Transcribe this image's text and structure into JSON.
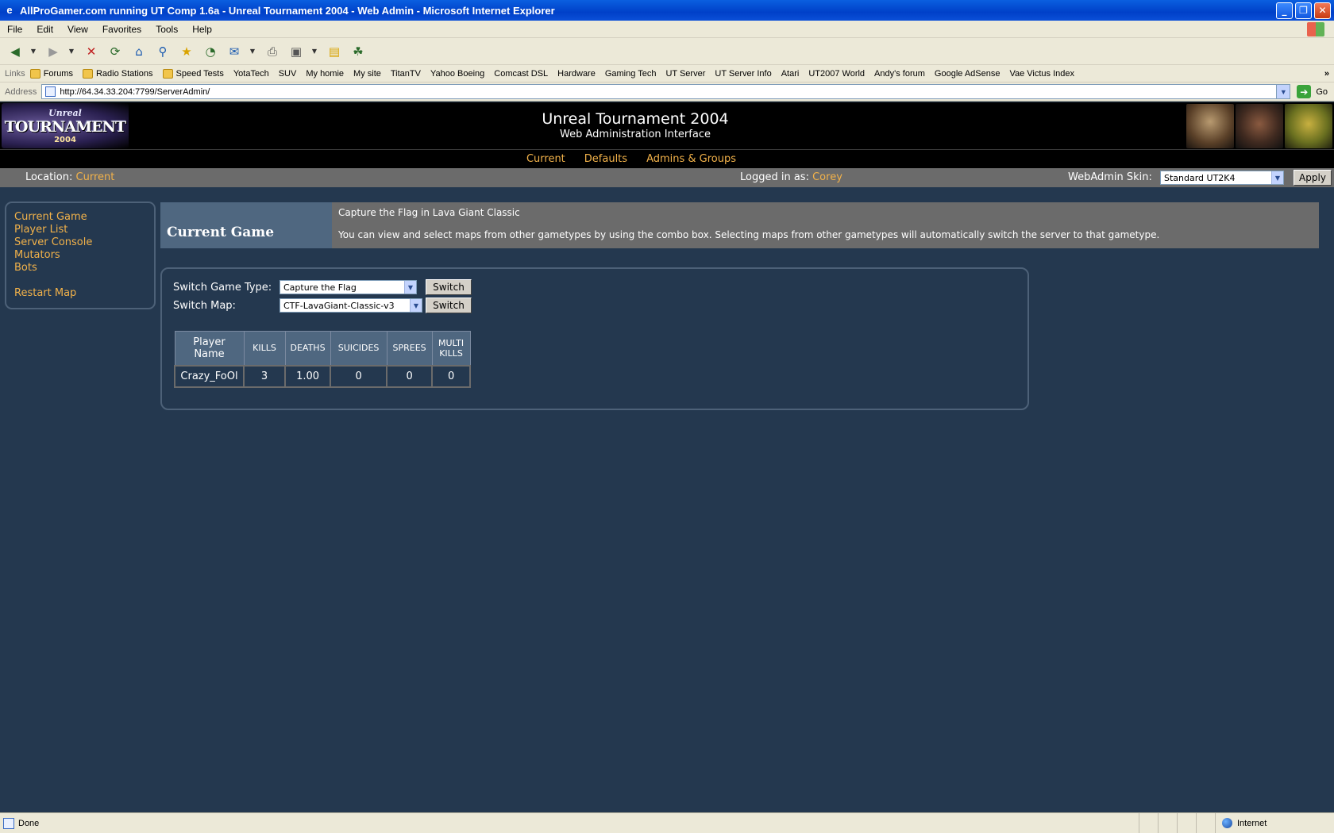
{
  "browser": {
    "title": "AllProGamer.com  running UT Comp 1.6a - Unreal Tournament 2004 - Web Admin - Microsoft Internet Explorer",
    "menu": [
      "File",
      "Edit",
      "View",
      "Favorites",
      "Tools",
      "Help"
    ],
    "links_label": "Links",
    "links": [
      {
        "label": "Forums",
        "icon": "folder-icon"
      },
      {
        "label": "Radio Stations",
        "icon": "folder-icon"
      },
      {
        "label": "Speed Tests",
        "icon": "folder-icon"
      },
      {
        "label": "YotaTech",
        "icon": "page-icon"
      },
      {
        "label": "SUV",
        "icon": "page-icon"
      },
      {
        "label": "My homie",
        "icon": "page-icon"
      },
      {
        "label": "My site",
        "icon": "page-icon"
      },
      {
        "label": "TitanTV",
        "icon": "page-icon"
      },
      {
        "label": "Yahoo Boeing",
        "icon": "page-icon"
      },
      {
        "label": "Comcast DSL",
        "icon": "page-icon"
      },
      {
        "label": "Hardware",
        "icon": "page-icon"
      },
      {
        "label": "Gaming Tech",
        "icon": "page-icon"
      },
      {
        "label": "UT Server",
        "icon": "page-icon"
      },
      {
        "label": "UT Server Info",
        "icon": "page-icon"
      },
      {
        "label": "Atari",
        "icon": "page-icon"
      },
      {
        "label": "UT2007 World",
        "icon": "page-icon"
      },
      {
        "label": "Andy's forum",
        "icon": "page-icon"
      },
      {
        "label": "Google AdSense",
        "icon": "page-icon"
      },
      {
        "label": "Vae Victus  Index",
        "icon": "page-icon"
      }
    ],
    "more_links": "»",
    "address_label": "Address",
    "address_url": "http://64.34.33.204:7799/ServerAdmin/",
    "go_label": "Go",
    "status_text": "Done",
    "zone_text": "Internet"
  },
  "header": {
    "logo": {
      "line1": "Unreal",
      "line2": "TOURNAMENT",
      "line3": "2004"
    },
    "title": "Unreal Tournament 2004",
    "subtitle": "Web Administration Interface"
  },
  "nav": [
    "Current",
    "Defaults",
    "Admins & Groups"
  ],
  "locbar": {
    "location_label": "Location:",
    "location_value": "Current",
    "logged_label": "Logged in as:",
    "logged_value": "Corey",
    "skin_label": "WebAdmin Skin:",
    "skin_value": "Standard UT2K4",
    "apply_label": "Apply"
  },
  "sidebar": {
    "items": [
      "Current Game",
      "Player List",
      "Server Console",
      "Mutators",
      "Bots"
    ],
    "extra": "Restart Map"
  },
  "banner": {
    "title": "Current Game",
    "line1": "Capture the Flag in Lava Giant Classic",
    "line2": "You can view and select maps from other gametypes by using the combo box. Selecting maps from other gametypes will automatically switch the server to that gametype."
  },
  "controls": {
    "gametype_label": "Switch Game Type:",
    "gametype_value": "Capture the Flag",
    "map_label": "Switch Map:",
    "map_value": "CTF-LavaGiant-Classic-v3",
    "switch_label": "Switch"
  },
  "table": {
    "headers": [
      "Player Name",
      "KILLS",
      "DEATHS",
      "SUICIDES",
      "SPREES",
      "MULTI KILLS"
    ],
    "rows": [
      [
        "Crazy_FoOl",
        "3",
        "1.00",
        "0",
        "0",
        "0"
      ]
    ]
  },
  "colors": {
    "accent": "#f2b24a",
    "page_bg": "#24384f",
    "banner_left": "#4f6780",
    "bar_gray": "#6b6b6b"
  }
}
